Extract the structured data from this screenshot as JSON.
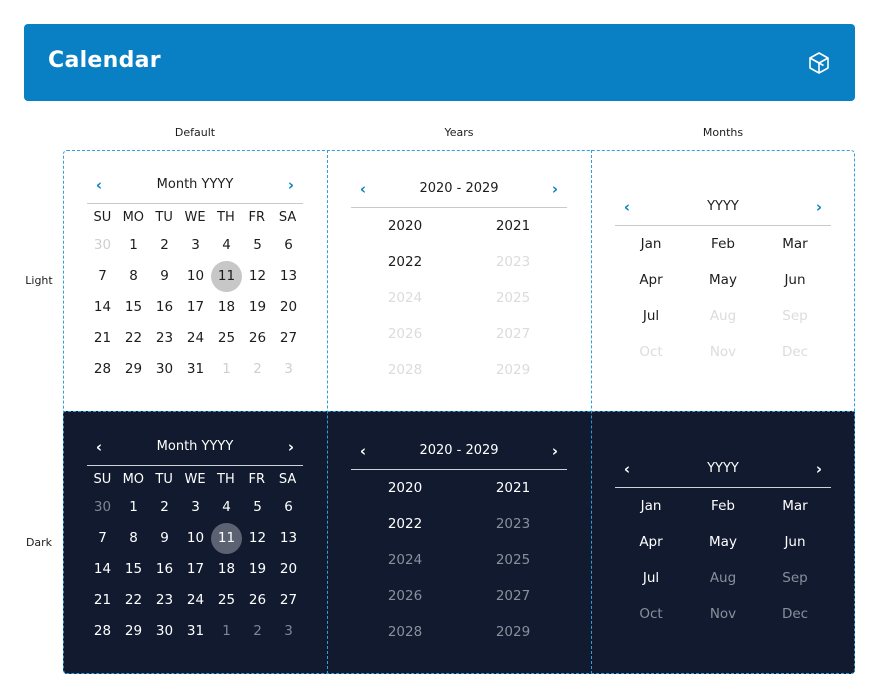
{
  "header": {
    "title": "Calendar",
    "logo_icon": "cube-logo-icon"
  },
  "columns": [
    "Default",
    "Years",
    "Months"
  ],
  "rows": [
    "Light",
    "Dark"
  ],
  "day_picker": {
    "title": "Month  YYYY",
    "weekdays": [
      "SU",
      "MO",
      "TU",
      "WE",
      "TH",
      "FR",
      "SA"
    ],
    "days": [
      {
        "d": "30",
        "m": true
      },
      {
        "d": "1"
      },
      {
        "d": "2"
      },
      {
        "d": "3"
      },
      {
        "d": "4"
      },
      {
        "d": "5"
      },
      {
        "d": "6"
      },
      {
        "d": "7"
      },
      {
        "d": "8"
      },
      {
        "d": "9"
      },
      {
        "d": "10"
      },
      {
        "d": "11",
        "s": true
      },
      {
        "d": "12"
      },
      {
        "d": "13"
      },
      {
        "d": "14"
      },
      {
        "d": "15"
      },
      {
        "d": "16"
      },
      {
        "d": "17"
      },
      {
        "d": "18"
      },
      {
        "d": "19"
      },
      {
        "d": "20"
      },
      {
        "d": "21"
      },
      {
        "d": "22"
      },
      {
        "d": "23"
      },
      {
        "d": "24"
      },
      {
        "d": "25"
      },
      {
        "d": "26"
      },
      {
        "d": "27"
      },
      {
        "d": "28"
      },
      {
        "d": "29"
      },
      {
        "d": "30"
      },
      {
        "d": "31"
      },
      {
        "d": "1",
        "m": true
      },
      {
        "d": "2",
        "m": true
      },
      {
        "d": "3",
        "m": true
      }
    ]
  },
  "year_picker": {
    "title": "2020 - 2029",
    "years": [
      {
        "y": "2020"
      },
      {
        "y": "2021"
      },
      {
        "y": "2022"
      },
      {
        "y": "2023",
        "off": true
      },
      {
        "y": "2024",
        "off": true
      },
      {
        "y": "2025",
        "off": true
      },
      {
        "y": "2026",
        "off": true
      },
      {
        "y": "2027",
        "off": true
      },
      {
        "y": "2028",
        "off": true
      },
      {
        "y": "2029",
        "off": true
      }
    ]
  },
  "month_picker": {
    "title": "YYYY",
    "months": [
      {
        "m": "Jan"
      },
      {
        "m": "Feb"
      },
      {
        "m": "Mar"
      },
      {
        "m": "Apr"
      },
      {
        "m": "May"
      },
      {
        "m": "Jun"
      },
      {
        "m": "Jul"
      },
      {
        "m": "Aug",
        "off": true
      },
      {
        "m": "Sep",
        "off": true
      },
      {
        "m": "Oct",
        "off": true
      },
      {
        "m": "Nov",
        "off": true
      },
      {
        "m": "Dec",
        "off": true
      }
    ]
  },
  "nav": {
    "prev": "‹",
    "next": "›"
  },
  "colors": {
    "accent": "#0980c3",
    "dark_bg": "#111a2e",
    "dash": "#2f9fdc"
  }
}
